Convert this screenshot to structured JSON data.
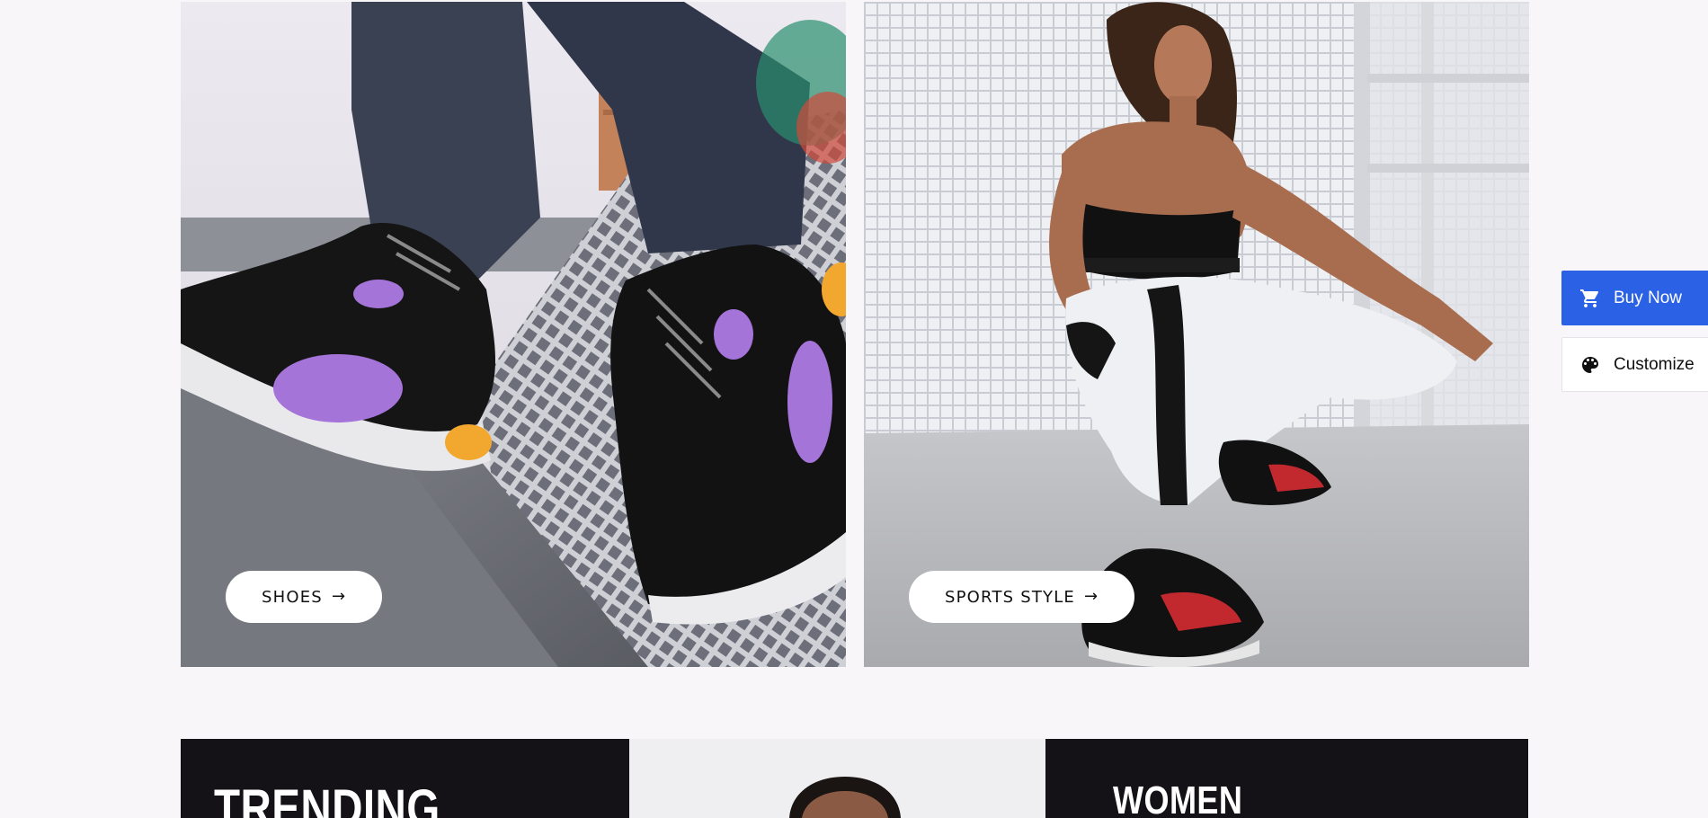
{
  "cards": {
    "shoes": {
      "label": "SHOES",
      "arrow": "→"
    },
    "sports": {
      "label": "SPORTS STYLE",
      "arrow": "→"
    }
  },
  "side_actions": {
    "buy_now": {
      "label": "Buy Now",
      "icon": "cart-icon"
    },
    "customize": {
      "label": "Customize",
      "icon": "palette-icon"
    }
  },
  "categories": {
    "trending": {
      "title": "TRENDING"
    },
    "women": {
      "title": "WOMEN"
    }
  },
  "colors": {
    "page_bg": "#f8f6f9",
    "accent_blue": "#2b62e5",
    "dark_panel": "#141216"
  }
}
